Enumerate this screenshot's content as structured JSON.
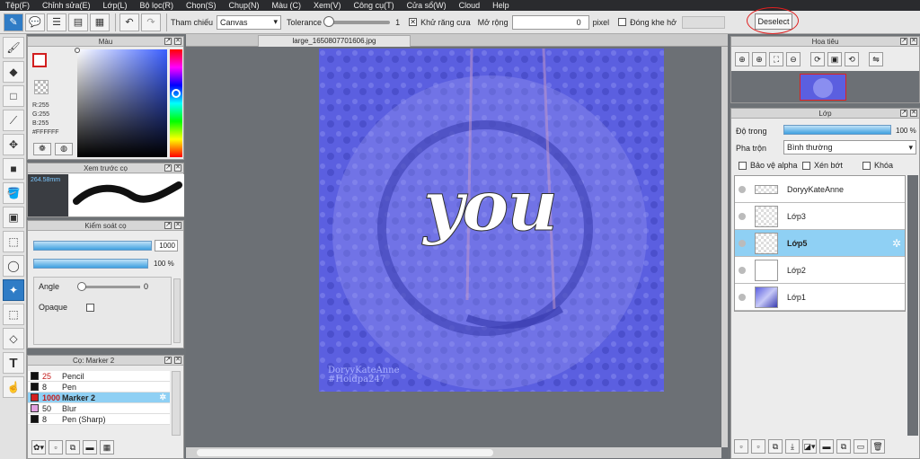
{
  "menu": [
    "Tệp(F)",
    "Chỉnh sửa(E)",
    "Lớp(L)",
    "Bộ lọc(R)",
    "Chọn(S)",
    "Chụp(N)",
    "Màu (C)",
    "Xem(V)",
    "Công cụ(T)",
    "Cửa sổ(W)",
    "Cloud",
    "Help"
  ],
  "toolbar": {
    "reference_label": "Tham chiếu",
    "reference_value": "Canvas",
    "tolerance_label": "Tolerance",
    "tolerance_value": "1",
    "antialias_label": "Khử răng cưa",
    "expand_label": "Mở rộng",
    "expand_value": "0",
    "expand_unit": "pixel",
    "close_gap_label": "Đóng khe hở",
    "deselect_label": "Deselect"
  },
  "color_panel": {
    "title": "Màu",
    "r": "R:255",
    "g": "G:255",
    "b": "B:255",
    "hex": "#FFFFFF"
  },
  "brush_preview": {
    "title": "Xem trước cọ",
    "size": "264.58mm"
  },
  "brush_control": {
    "title": "Kiểm soát cọ",
    "size_value": "1000",
    "opacity_value": "100 %",
    "angle_label": "Angle",
    "angle_value": "0",
    "opaque_label": "Opaque"
  },
  "brush_list": {
    "title": "Cọ: Marker 2",
    "items": [
      {
        "size": "25",
        "name": "Pencil",
        "color": "#111111"
      },
      {
        "size": "8",
        "name": "Pen",
        "color": "#111111"
      },
      {
        "size": "1000",
        "name": "Marker 2",
        "color": "#d21f1f"
      },
      {
        "size": "50",
        "name": "Blur",
        "color": "#e0a0e0"
      },
      {
        "size": "8",
        "name": "Pen (Sharp)",
        "color": "#111111"
      }
    ]
  },
  "canvas": {
    "filename": "large_1650807701606.jpg",
    "art_text": "you",
    "watermark_line1": "DoryyKateAnne",
    "watermark_line2": "#Hoidpa247"
  },
  "navigator": {
    "title": "Hoa tiêu"
  },
  "layers": {
    "title": "Lớp",
    "opacity_label": "Độ trong",
    "opacity_value": "100 %",
    "blend_label": "Pha trộn",
    "blend_value": "Bình thường",
    "protect_alpha_label": "Bảo vệ alpha",
    "clip_label": "Xén bớt",
    "lock_label": "Khóa",
    "items": [
      {
        "name": "DoryyKateAnne"
      },
      {
        "name": "Lớp3"
      },
      {
        "name": "Lớp5"
      },
      {
        "name": "Lớp2"
      },
      {
        "name": "Lớp1"
      }
    ]
  },
  "colors": {
    "accent": "#2f7cc6",
    "selection": "#8fd0f4",
    "canvas_bg": "#5b5fe0"
  }
}
